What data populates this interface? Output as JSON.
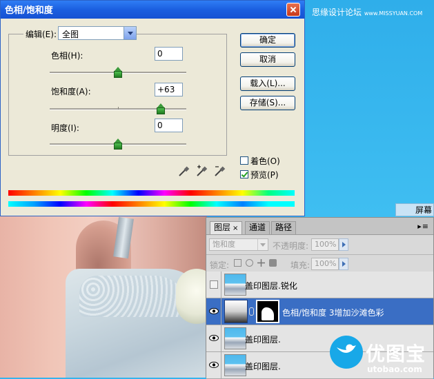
{
  "watermark": {
    "text": "思缘设计论坛",
    "site": "www.MISSYUAN.COM"
  },
  "screen_chip": "屏幕",
  "dialog": {
    "title": "色相/饱和度",
    "edit_label": "编辑(E):",
    "edit_value": "全图",
    "hue": {
      "label": "色相(H):",
      "value": "0",
      "level": 0.5
    },
    "saturation": {
      "label": "饱和度(A):",
      "value": "+63",
      "level": 0.815
    },
    "lightness": {
      "label": "明度(I):",
      "value": "0",
      "level": 0.5
    },
    "buttons": {
      "ok": "确定",
      "cancel": "取消",
      "load": "载入(L)...",
      "save": "存储(S)..."
    },
    "colorize": {
      "label": "着色(O)",
      "checked": false
    },
    "preview": {
      "label": "预览(P)",
      "checked": true
    },
    "icons": [
      "eyedropper-icon",
      "eyedropper-plus-icon",
      "eyedropper-minus-icon"
    ]
  },
  "layers_panel": {
    "tabs": [
      "图层",
      "通道",
      "路径"
    ],
    "tab_close": "×",
    "menu_glyph": "▸≡",
    "blend_mode": "饱和度",
    "opacity_label": "不透明度:",
    "opacity_value": "100%",
    "lock_label": "锁定:",
    "fill_label": "填充:",
    "fill_value": "100%",
    "layers": [
      {
        "name": "盖印图层.锐化",
        "visible": false,
        "selected": false,
        "type": "photo"
      },
      {
        "name": "色相/饱和度 3增加沙滩色彩",
        "visible": true,
        "selected": true,
        "type": "adjustment"
      },
      {
        "name": "盖印图层.",
        "visible": true,
        "selected": false,
        "type": "photo"
      },
      {
        "name": "盖印图层.",
        "visible": true,
        "selected": false,
        "type": "photo"
      }
    ]
  },
  "logo": {
    "name": "优图宝",
    "url": "utobao.com"
  },
  "colors": {
    "titlebar": "#1b5fe0",
    "selected_layer": "#3a6ec4",
    "background_sky": "#35b3ec"
  }
}
